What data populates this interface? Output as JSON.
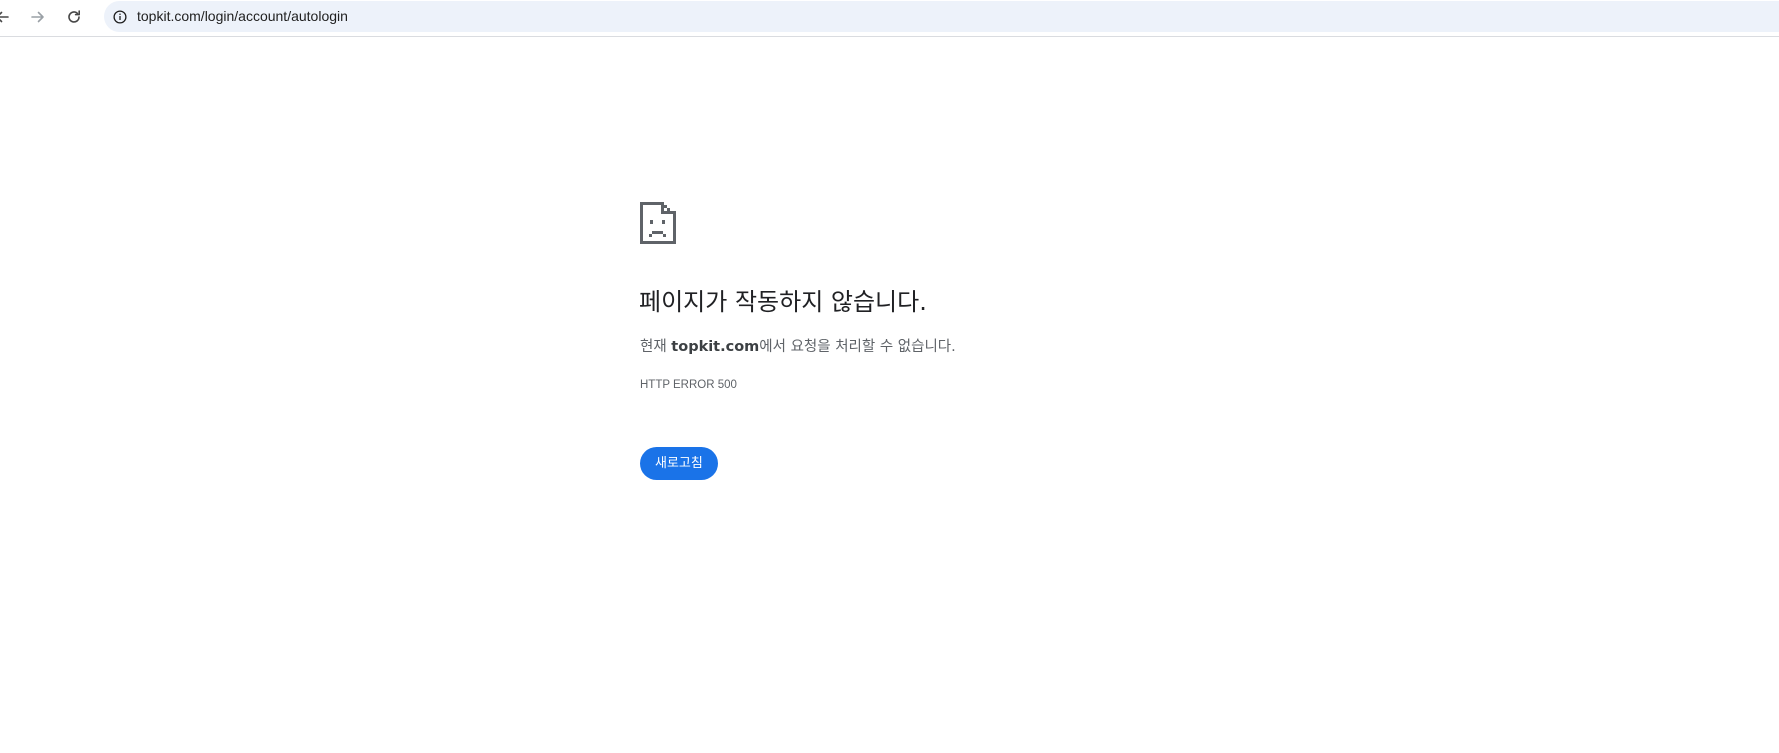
{
  "browser": {
    "url": "topkit.com/login/account/autologin",
    "icons": {
      "back": "back-arrow-icon",
      "forward": "forward-arrow-icon",
      "reload": "reload-icon",
      "site_info": "info-icon"
    }
  },
  "error_page": {
    "icon": "sad-page-icon",
    "heading": "페이지가 작동하지 않습니다.",
    "summary_prefix": "현재 ",
    "summary_host": "topkit.com",
    "summary_suffix": "에서 요청을 처리할 수 없습니다.",
    "error_code": "HTTP ERROR 500",
    "reload_label": "새로고침"
  },
  "colors": {
    "accent": "#1a73e8",
    "omnibox_bg": "#edf2fa",
    "heading": "#202124",
    "secondary_text": "#5f6368",
    "icon": "#5f6368"
  }
}
